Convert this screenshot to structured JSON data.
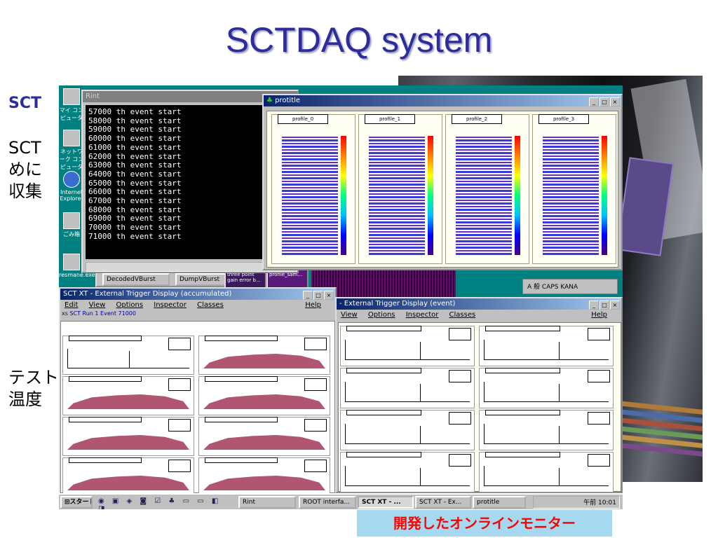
{
  "slide": {
    "title": "SCTDAQ system",
    "heading_partial": "SCT",
    "para1_lines": [
      "SCT",
      "めに",
      "収集"
    ],
    "para2_lines": [
      "テスト",
      "温度"
    ],
    "caption": "開発したオンラインモニター"
  },
  "desktop": {
    "icons": [
      {
        "label": "マイ コンピュータ",
        "icon": "computer-icon"
      },
      {
        "label": "ネットワーク コンピュータ",
        "icon": "network-icon"
      },
      {
        "label": "Internet Explorer",
        "icon": "ie-icon"
      },
      {
        "label": "ごみ箱",
        "icon": "recycle-bin-icon"
      },
      {
        "label": "resmane.exe",
        "icon": "program-icon"
      }
    ]
  },
  "rint": {
    "title": "Rint",
    "lines": [
      "57000 th event start",
      "58000 th event start",
      "59000 th event start",
      "60000 th event start",
      "61000 th event start",
      "62000 th event start",
      "63000 th event start",
      "64000 th event start",
      "65000 th event start",
      "66000 th event start",
      "67000 th event start",
      "68000 th event start",
      "69000 th event start",
      "70000 th event start",
      "71000 th event start"
    ]
  },
  "protitle": {
    "title": "protitle",
    "panels": [
      "profile_0",
      "profile_1",
      "profile_2",
      "profile_3"
    ]
  },
  "bg_buttons": {
    "decoded": "DecodedVBurst",
    "dump": "DumpVBurst",
    "gain": "three point gain error b...",
    "profile": "profile_sam..."
  },
  "accumulated": {
    "title": "SCT XT - External Trigger Display (accumulated)",
    "menu": [
      "Edit",
      "View",
      "Options",
      "Inspector",
      "Classes"
    ],
    "help": "Help",
    "info": "xs SCT   Run 1  Event 71000"
  },
  "event": {
    "title": "- External Trigger Display (event)",
    "menu": [
      "View",
      "Options",
      "Inspector",
      "Classes"
    ],
    "help": "Help"
  },
  "tray_bar": {
    "text": "A 般 CAPS KANA"
  },
  "taskbar": {
    "start": "スタート",
    "buttons": [
      "Rint",
      "ROOT interfa...",
      "SCT XT - ...",
      "SCT XT - Ex...",
      "protitle"
    ],
    "active_index": 2,
    "clock": "午前 10:01"
  },
  "colors": {
    "title": "#2c2c9c",
    "caption_bg": "#a6d9f0",
    "caption_text": "#ff0000",
    "hist_fill": "#b05670",
    "desktop": "#008080"
  }
}
